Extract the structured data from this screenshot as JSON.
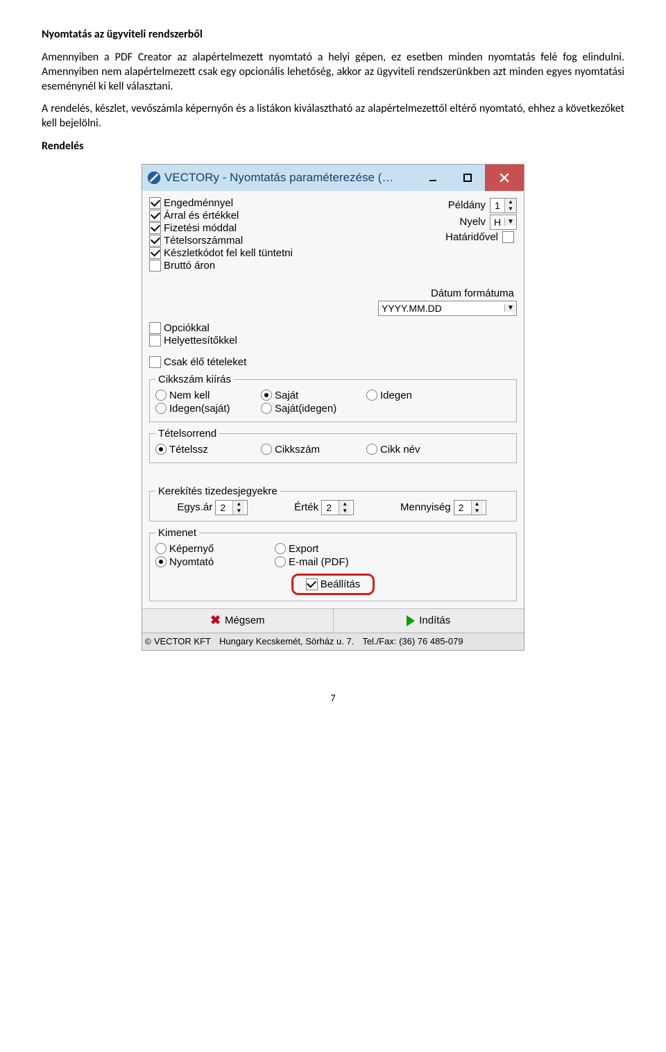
{
  "doc": {
    "heading": "Nyomtatás az ügyviteli rendszerből",
    "para1": "Amennyiben a PDF Creator az alapértelmezett nyomtató a helyi gépen, ez esetben minden nyomtatás felé fog elindulni. Amennyiben nem alapértelmezett csak egy opcionális lehetőség, akkor az ügyviteli rendszerünkben azt minden egyes nyomtatási eseménynél ki kell választani.",
    "para2": "A rendelés, készlet, vevőszámla képernyőn és a listákon kiválasztható az alapértelmezettől eltérő nyomtató, ehhez a következőket kell bejelölni.",
    "subhead": "Rendelés",
    "page_number": "7"
  },
  "win": {
    "title": "VECTORy - Nyomtatás paraméterezése (…",
    "left_checks": [
      {
        "label": "Engedménnyel",
        "checked": true
      },
      {
        "label": "Árral és értékkel",
        "checked": true
      },
      {
        "label": "Fizetési móddal",
        "checked": true
      },
      {
        "label": "Tételsorszámmal",
        "checked": true
      },
      {
        "label": "Készletkódot fel  kell tüntetni",
        "checked": true
      },
      {
        "label": "Bruttó áron",
        "checked": false
      }
    ],
    "right": {
      "peldany_label": "Példány",
      "peldany_value": "1",
      "nyelv_label": "Nyelv",
      "nyelv_value": "H",
      "hataridovel_label": "Határidővel"
    },
    "date": {
      "label": "Dátum formátuma",
      "value": "YYYY.MM.DD"
    },
    "mid_checks": [
      {
        "label": "Opciókkal",
        "checked": false
      },
      {
        "label": "Helyettesítőkkel",
        "checked": false
      }
    ],
    "csak_elo": {
      "label": "Csak élő tételeket",
      "checked": false
    },
    "cikkszam": {
      "legend": "Cikkszám kiírás",
      "opts1": [
        {
          "label": "Nem kell",
          "selected": false
        },
        {
          "label": "Saját",
          "selected": true
        },
        {
          "label": "Idegen",
          "selected": false
        }
      ],
      "opts2": [
        {
          "label": "Idegen(saját)",
          "selected": false
        },
        {
          "label": "Saját(idegen)",
          "selected": false
        }
      ]
    },
    "tetelsorrend": {
      "legend": "Tételsorrend",
      "opts": [
        {
          "label": "Tételssz",
          "selected": true
        },
        {
          "label": "Cikkszám",
          "selected": false
        },
        {
          "label": "Cikk név",
          "selected": false
        }
      ]
    },
    "kerekites": {
      "legend": "Kerekítés tizedesjegyekre",
      "items": [
        {
          "label": "Egys.ár",
          "value": "2"
        },
        {
          "label": "Érték",
          "value": "2"
        },
        {
          "label": "Mennyiség",
          "value": "2"
        }
      ]
    },
    "kimenet": {
      "legend": "Kimenet",
      "row1": [
        {
          "label": "Képernyő",
          "selected": false
        },
        {
          "label": "Export",
          "selected": false
        }
      ],
      "row2": [
        {
          "label": "Nyomtató",
          "selected": true
        },
        {
          "label": "E-mail (PDF)",
          "selected": false
        }
      ],
      "beallitas": {
        "label": "Beállítás",
        "checked": true
      }
    },
    "buttons": {
      "cancel": "Mégsem",
      "start": "Indítás"
    },
    "status": {
      "company": "VECTOR KFT",
      "address": "Hungary Kecskemét, Sörház u. 7.",
      "phone": "Tel./Fax: (36) 76 485-079"
    }
  }
}
